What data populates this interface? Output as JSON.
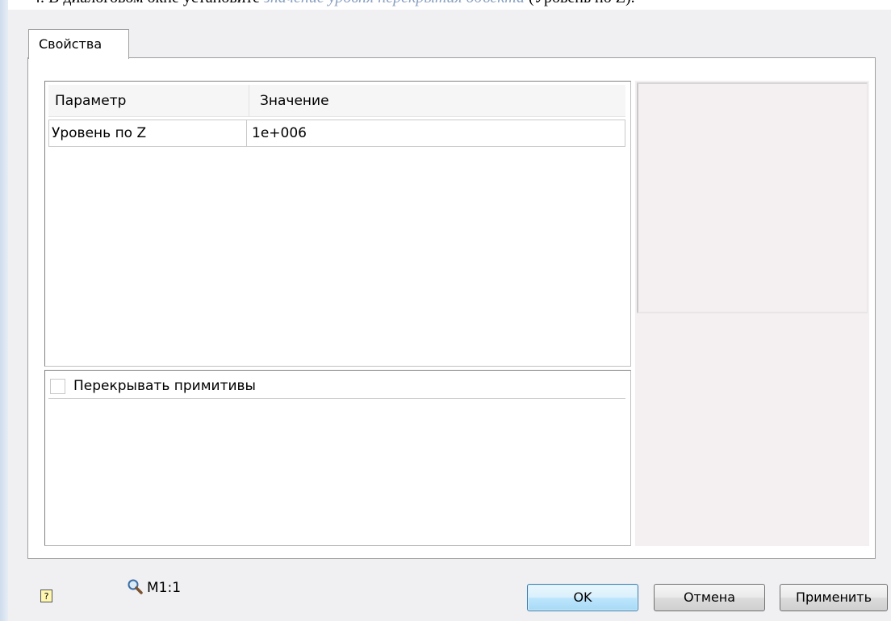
{
  "instruction": {
    "prefix": "4.   В диалоговом окне установите ",
    "italic": "значение уровня перекрытия объекта",
    "suffix": " (Уровень по Z)."
  },
  "tab": {
    "label": "Свойства"
  },
  "grid": {
    "headers": [
      "Параметр",
      "Значение"
    ],
    "rows": [
      [
        "Уровень по Z",
        "1e+006"
      ]
    ]
  },
  "checkbox": {
    "label": "Перекрывать примитивы",
    "checked": false
  },
  "footer": {
    "help_icon": "help-icon",
    "zoom_icon": "magnifier-icon",
    "zoom_label": "M1:1",
    "ok_label": "OK",
    "cancel_label": "Отмена",
    "apply_label": "Применить"
  },
  "colors": {
    "dialog_bg": "#f0eff1",
    "preview_bg": "#f4eff1",
    "ok_border": "#3c7fb1"
  }
}
